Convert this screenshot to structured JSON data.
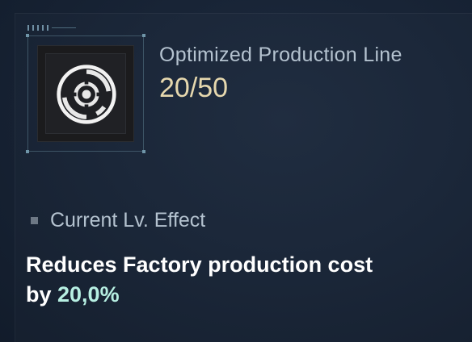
{
  "skill": {
    "name": "Optimized Production Line",
    "level": "20/50",
    "icon": "cog-ring-icon"
  },
  "effect": {
    "heading": "Current Lv. Effect",
    "text_line1": "Reduces Factory production cost",
    "text_prefix": "by ",
    "value": "20,0%"
  },
  "colors": {
    "background": "#182436",
    "title_text": "#b4c2cf",
    "level_text": "#e6d8ae",
    "highlight_value": "#b7efe2"
  }
}
